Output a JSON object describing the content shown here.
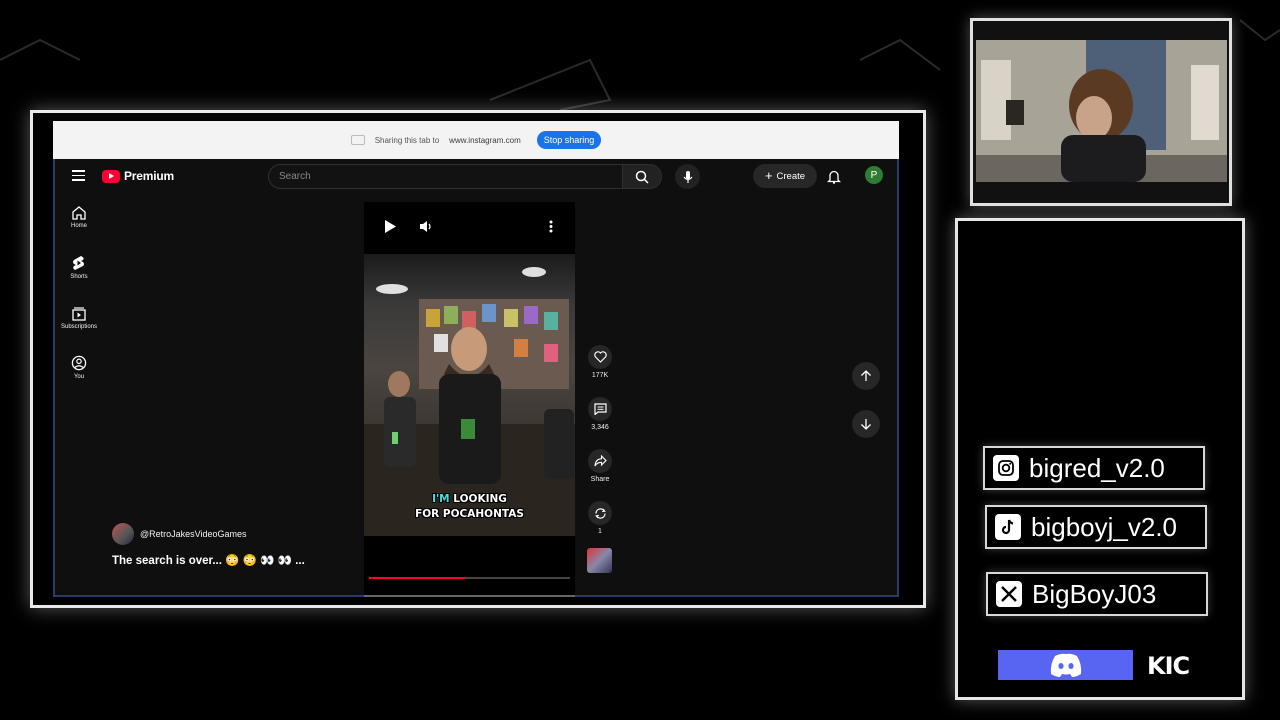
{
  "share_bar": {
    "text": "Sharing this tab to",
    "url": "www.instagram.com",
    "stop_label": "Stop sharing"
  },
  "youtube": {
    "brand": "Premium",
    "search_placeholder": "Search",
    "create_label": "Create",
    "avatar_letter": "P",
    "guide": [
      {
        "label": "Home",
        "icon": "home-icon"
      },
      {
        "label": "Shorts",
        "icon": "shorts-icon"
      },
      {
        "label": "Subscriptions",
        "icon": "subscriptions-icon"
      },
      {
        "label": "You",
        "icon": "you-icon"
      }
    ],
    "short": {
      "caption_highlight": "I'M",
      "caption_line1_rest": " LOOKING",
      "caption_line2": "FOR POCAHONTAS",
      "progress": 0.48,
      "likes": "177K",
      "comments": "3,346",
      "share_label": "Share",
      "remix_count": "1",
      "channel": "@RetroJakesVideoGames",
      "title": "The search is over... 😳 😳 👀 👀 ..."
    },
    "accent_red": "#ff0033"
  },
  "socials": {
    "instagram": "bigred_v2.0",
    "tiktok": "bigboyj_v2.0",
    "x": "BigBoyJ03",
    "kick": "KIC"
  }
}
